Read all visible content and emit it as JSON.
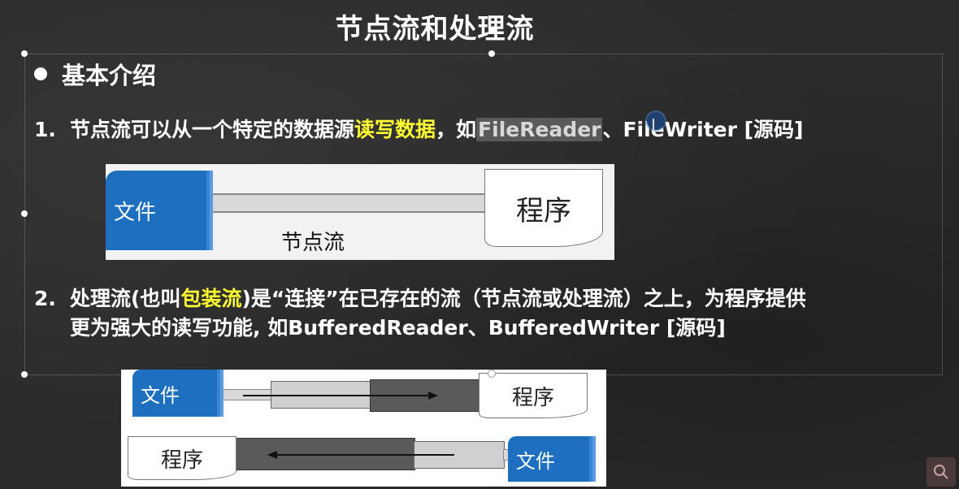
{
  "slide": {
    "title": "节点流和处理流",
    "bullet": "基本介绍",
    "item1": {
      "num": "1.",
      "pre": "节点流可以从一个特定的数据源",
      "highlight": "读写数据",
      "mid": "，如",
      "selected": "FileReader",
      "post": "、FileWriter [源码]"
    },
    "item2": {
      "num": "2.",
      "pre": "处理流(也叫",
      "highlight": "包装流",
      "post": ")是“连接”在已存在的流（节点流或处理流）之上，为程序提供",
      "line2": "更为强大的读写功能, 如BufferedReader、BufferedWriter [源码]"
    }
  },
  "diagram1": {
    "file": "文件",
    "program": "程序",
    "stream": "节点流"
  },
  "diagram2": {
    "top_file": "文件",
    "top_program": "程序",
    "bottom_program": "程序",
    "bottom_file": "文件"
  },
  "icons": {
    "search": "search-icon",
    "cursor": "text-cursor-icon"
  },
  "colors": {
    "background": "#2b2b2b",
    "highlight_yellow": "#ffff33",
    "file_blue": "#1e6fc0"
  }
}
